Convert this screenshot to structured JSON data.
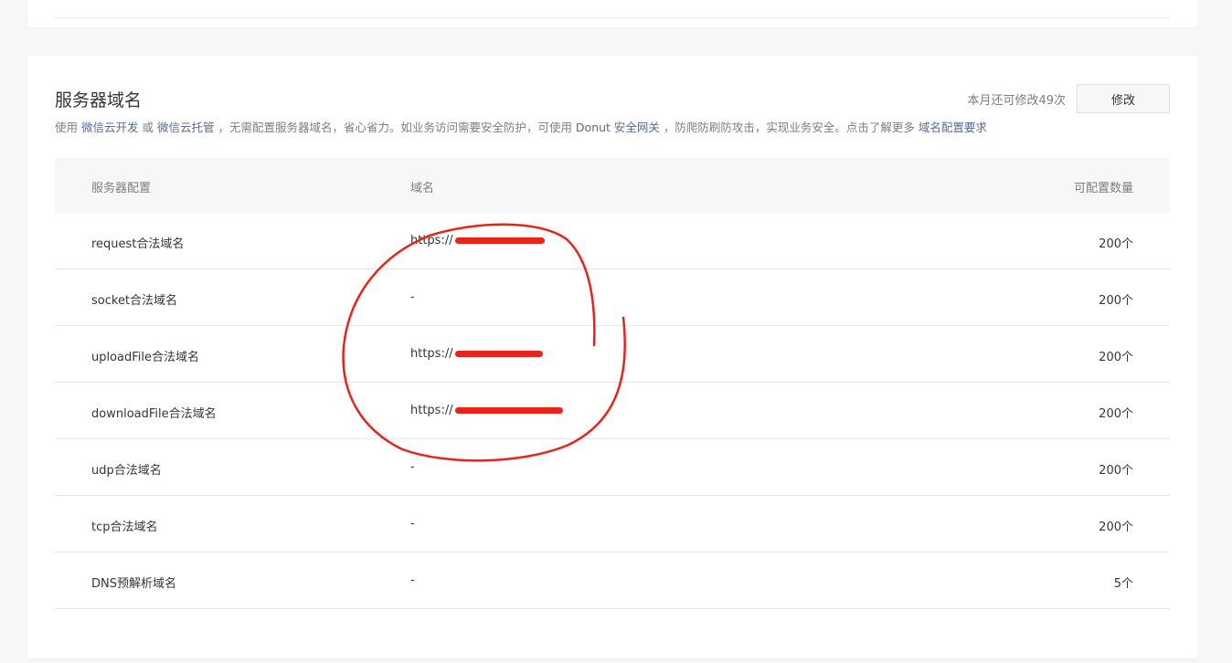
{
  "section": {
    "title": "服务器域名",
    "quota_text": "本月还可修改49次",
    "edit_label": "修改",
    "description": {
      "p1": "使用 ",
      "link1": "微信云开发",
      "p2": " 或 ",
      "link2": "微信云托管",
      "p3": " ，无需配置服务器域名，省心省力。如业务访问需要安全防护，可使用 ",
      "link3": "Donut 安全网关",
      "p4": " ，防爬防刷防攻击，实现业务安全。点击了解更多 ",
      "link4": "域名配置要求"
    }
  },
  "table": {
    "headers": [
      "服务器配置",
      "域名",
      "可配置数量"
    ],
    "rows": [
      {
        "config": "request合法域名",
        "domain": "https://",
        "count": "200个"
      },
      {
        "config": "socket合法域名",
        "domain": "-",
        "count": "200个"
      },
      {
        "config": "uploadFile合法域名",
        "domain": "https://",
        "count": "200个"
      },
      {
        "config": "downloadFile合法域名",
        "domain": "https://",
        "count": "200个"
      },
      {
        "config": "udp合法域名",
        "domain": "-",
        "count": "200个"
      },
      {
        "config": "tcp合法域名",
        "domain": "-",
        "count": "200个"
      },
      {
        "config": "DNS预解析域名",
        "domain": "-",
        "count": "5个"
      }
    ]
  },
  "colors": {
    "link": "#576b95",
    "annotation": "#e8231a"
  }
}
